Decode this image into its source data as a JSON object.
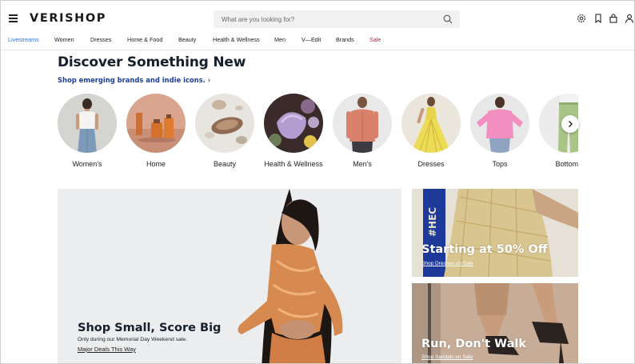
{
  "header": {
    "logo": "VERISHOP",
    "search_placeholder": "What are you looking for?"
  },
  "nav": {
    "items": [
      {
        "label": "Livestreams",
        "color": "#2f76d6"
      },
      {
        "label": "Women"
      },
      {
        "label": "Dresses"
      },
      {
        "label": "Home & Food"
      },
      {
        "label": "Beauty"
      },
      {
        "label": "Health & Wellness"
      },
      {
        "label": "Men"
      },
      {
        "label": "V—Edit"
      },
      {
        "label": "Brands"
      },
      {
        "label": "Sale",
        "color": "#c2262e"
      }
    ]
  },
  "discover": {
    "title": "Discover Something New",
    "subtitle": "Shop emerging brands and indie icons. ›",
    "categories": [
      {
        "label": "Women's"
      },
      {
        "label": "Home"
      },
      {
        "label": "Beauty"
      },
      {
        "label": "Health & Wellness"
      },
      {
        "label": "Men's"
      },
      {
        "label": "Dresses"
      },
      {
        "label": "Tops"
      },
      {
        "label": "Bottoms"
      }
    ]
  },
  "hero": {
    "title": "Shop Small, Score Big",
    "subtitle": "Only during our Memorial Day Weekend sale.",
    "link": "Major Deals This Way"
  },
  "promos": [
    {
      "title": "Starting at 50% Off",
      "link": "Shop Dresses on Sale"
    },
    {
      "title": "Run, Don't Walk",
      "link": "Shop Sandals on Sale"
    }
  ],
  "colors": {
    "title": "#16202d",
    "link_blue": "#1f3f9c",
    "livestreams": "#2f76d6",
    "sale": "#c2262e"
  }
}
